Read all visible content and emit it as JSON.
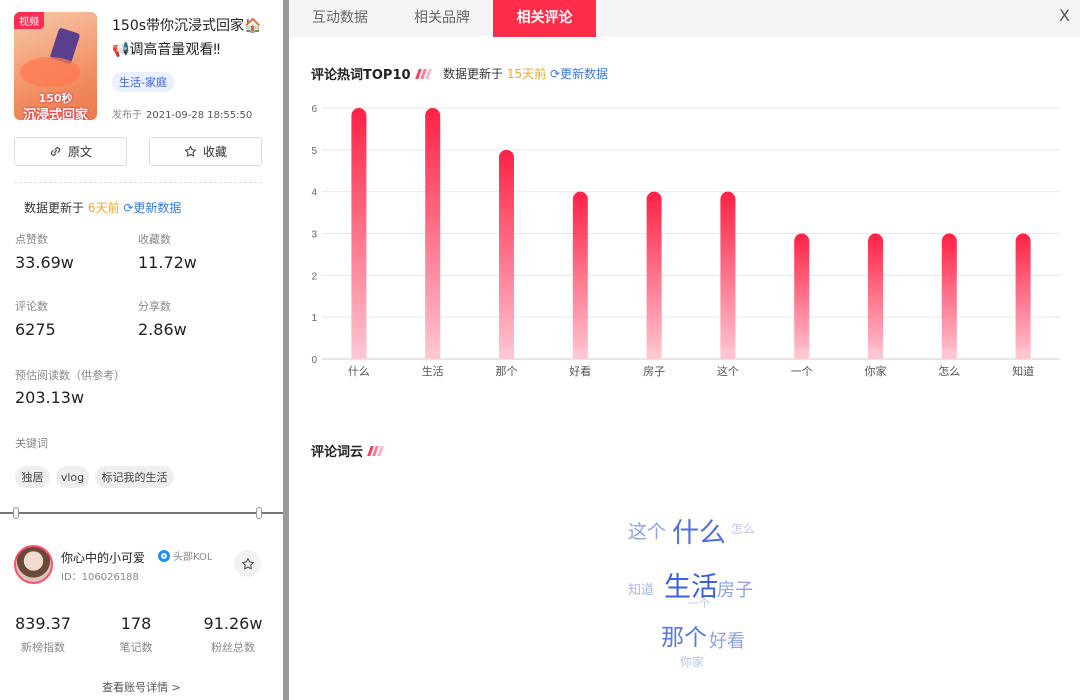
{
  "note": {
    "badge": "视频",
    "thumb_line1": "150秒",
    "thumb_line2": "沉浸式回家",
    "title": "150s带你沉浸式回家🏠📢调高音量观看‼",
    "category": "生活-家庭",
    "published_prefix": "发布于",
    "published_at": "2021-09-28 18:55:50",
    "original_button": "原文",
    "favorite_button": "收藏"
  },
  "update": {
    "prefix": "数据更新于",
    "days": "6天前",
    "refresh": "更新数据"
  },
  "stats": {
    "likes_label": "点赞数",
    "likes": "33.69w",
    "collects_label": "收藏数",
    "collects": "11.72w",
    "comments_label": "评论数",
    "comments": "6275",
    "shares_label": "分享数",
    "shares": "2.86w",
    "reads_label": "预估阅读数（供参考）",
    "reads": "203.13w"
  },
  "keywords": {
    "label": "关键词",
    "items": [
      "独居",
      "vlog",
      "标记我的生活"
    ]
  },
  "account": {
    "name": "你心中的小可爱",
    "badge": "头部KOL",
    "id": "ID：106026188",
    "index_val": "839.37",
    "index_label": "新榜指数",
    "notes_val": "178",
    "notes_label": "笔记数",
    "fans_val": "91.26w",
    "fans_label": "粉丝总数",
    "detail_link": "查看账号详情 >"
  },
  "tabs": [
    "互动数据",
    "相关品牌",
    "相关评论"
  ],
  "active_tab": 2,
  "close_label": "X",
  "top10": {
    "title": "评论热词TOP10",
    "update_prefix": "数据更新于",
    "update_days": "15天前",
    "refresh": "更新数据"
  },
  "chart_data": {
    "type": "bar",
    "title": "评论热词TOP10",
    "categories": [
      "什么",
      "生活",
      "那个",
      "好看",
      "房子",
      "这个",
      "一个",
      "你家",
      "怎么",
      "知道"
    ],
    "values": [
      6,
      6,
      5,
      4,
      4,
      4,
      3,
      3,
      3,
      3
    ],
    "ylim": [
      0,
      6
    ],
    "yticks": [
      0,
      1,
      2,
      3,
      4,
      5,
      6
    ],
    "grid": true,
    "colors": {
      "bar_top": "#ff2145",
      "bar_bottom": "#ffc6d2",
      "axis": "#cccccc",
      "grid": "#e8e8e8"
    }
  },
  "cloud": {
    "title": "评论词云",
    "words": [
      {
        "text": "这个",
        "color": "#8ea2e8"
      },
      {
        "text": "什么",
        "color": "#4f6fdf"
      },
      {
        "text": "怎么",
        "color": "#b9c5f0"
      },
      {
        "text": "知道",
        "color": "#a9b7ee"
      },
      {
        "text": "生活",
        "color": "#3e5fe0"
      },
      {
        "text": "房子",
        "color": "#8ea2e8"
      },
      {
        "text": "一个",
        "color": "#b9c5f0"
      },
      {
        "text": "那个",
        "color": "#5a78e2"
      },
      {
        "text": "好看",
        "color": "#8ea2e8"
      },
      {
        "text": "你家",
        "color": "#b9c5f0"
      }
    ]
  }
}
